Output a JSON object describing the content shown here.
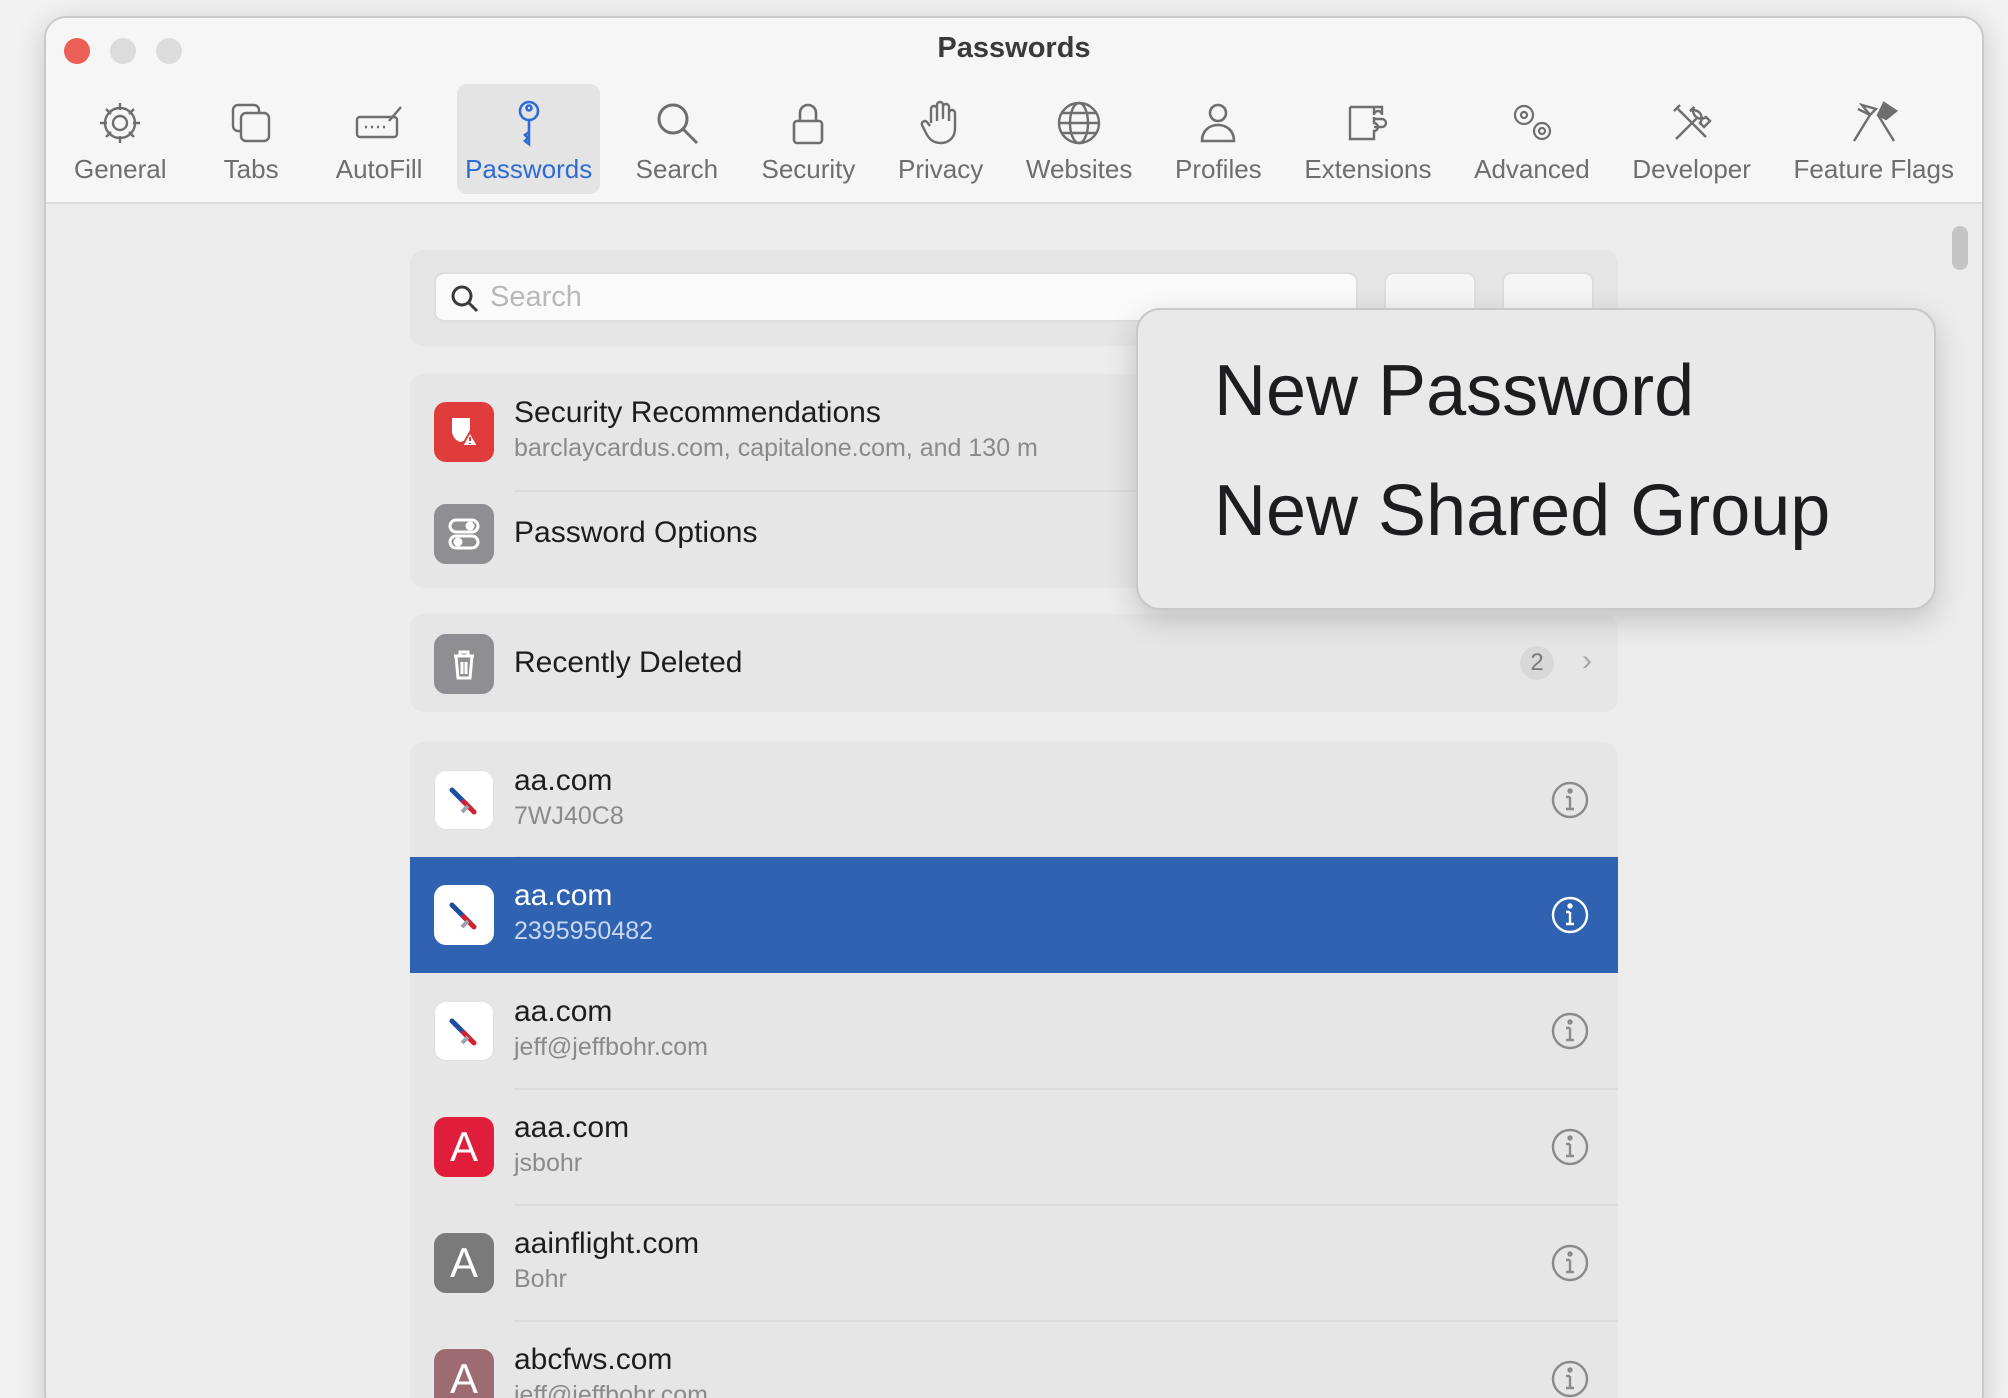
{
  "window": {
    "title": "Passwords"
  },
  "toolbar": {
    "items": [
      {
        "label": "General",
        "icon": "gear-icon"
      },
      {
        "label": "Tabs",
        "icon": "tabs-icon"
      },
      {
        "label": "AutoFill",
        "icon": "autofill-icon"
      },
      {
        "label": "Passwords",
        "icon": "key-icon",
        "active": true
      },
      {
        "label": "Search",
        "icon": "search-icon"
      },
      {
        "label": "Security",
        "icon": "lock-icon"
      },
      {
        "label": "Privacy",
        "icon": "hand-icon"
      },
      {
        "label": "Websites",
        "icon": "globe-icon"
      },
      {
        "label": "Profiles",
        "icon": "person-icon"
      },
      {
        "label": "Extensions",
        "icon": "puzzle-icon"
      },
      {
        "label": "Advanced",
        "icon": "gears-icon"
      },
      {
        "label": "Developer",
        "icon": "tools-icon"
      },
      {
        "label": "Feature Flags",
        "icon": "flags-icon"
      }
    ]
  },
  "search": {
    "placeholder": "Search"
  },
  "summary": {
    "security": {
      "title": "Security Recommendations",
      "subtitle": "barclaycardus.com, capitalone.com, and 130 m"
    },
    "options": {
      "title": "Password Options"
    },
    "deleted": {
      "title": "Recently Deleted",
      "count": "2"
    }
  },
  "passwords": [
    {
      "site": "aa.com",
      "user": "7WJ40C8",
      "icon": "american-airlines-icon"
    },
    {
      "site": "aa.com",
      "user": "2395950482",
      "icon": "american-airlines-icon",
      "selected": true
    },
    {
      "site": "aa.com",
      "user": "jeff@jeffbohr.com",
      "icon": "american-airlines-icon"
    },
    {
      "site": "aaa.com",
      "user": "jsbohr",
      "icon": "letter-a-icon",
      "letter": "A"
    },
    {
      "site": "aainflight.com",
      "user": "Bohr",
      "icon": "letter-a-icon",
      "letter": "A"
    },
    {
      "site": "abcfws.com",
      "user": "jeff@jeffbohr.com",
      "icon": "letter-a-icon",
      "letter": "A"
    }
  ],
  "popover_menu": {
    "new_password": "New Password",
    "new_shared_group": "New Shared Group"
  },
  "colors": {
    "accent": "#2e6bd4",
    "selection": "#2f63b2",
    "security_red": "#e03b3b",
    "aaa_red": "#e11d3c",
    "gray_letter": "#7a7a7a",
    "mauve_letter": "#9e6b72"
  }
}
